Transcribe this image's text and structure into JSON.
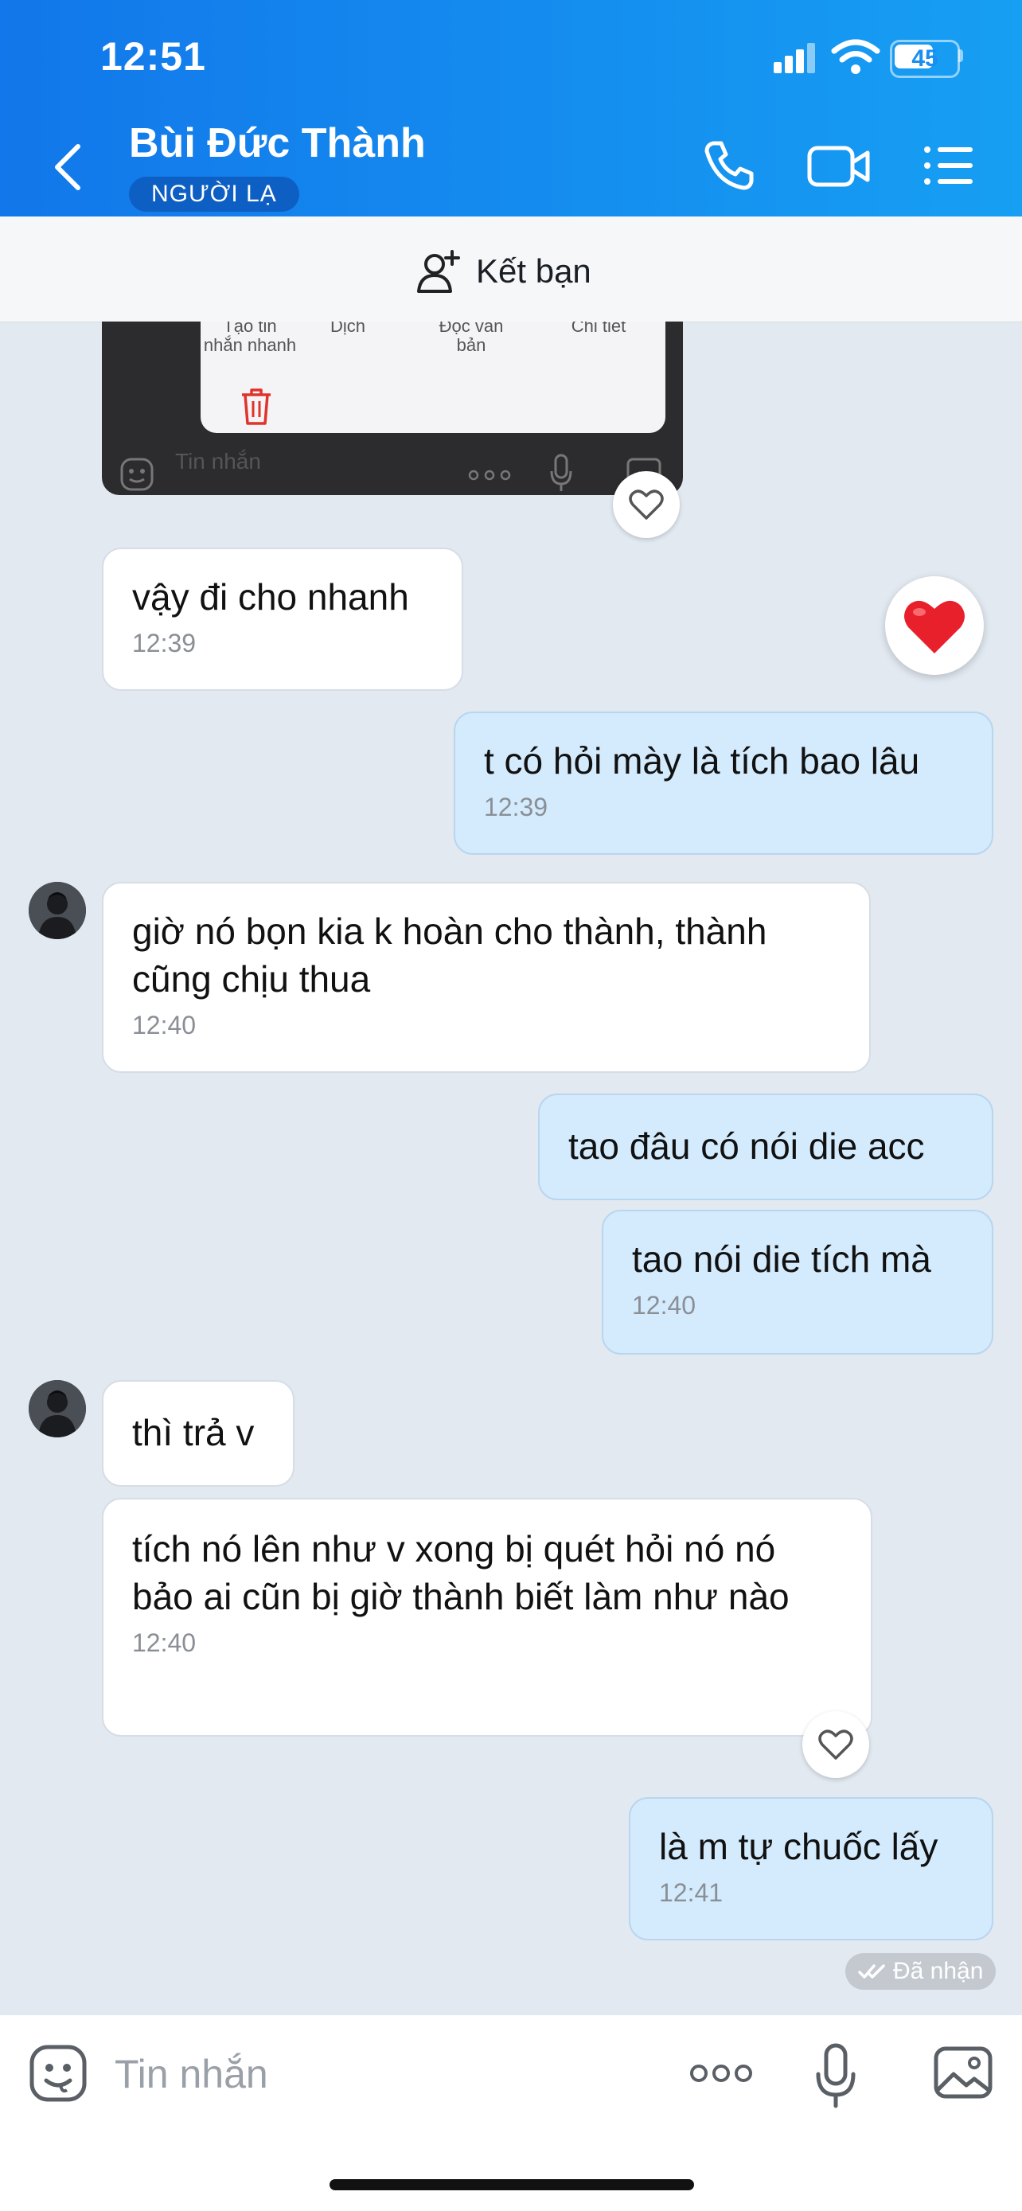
{
  "status": {
    "time": "12:51",
    "battery": "45"
  },
  "header": {
    "contact_name": "Bùi Đức Thành",
    "badge": "NGƯỜI LẠ"
  },
  "friend_bar": {
    "label": "Kết bạn"
  },
  "quoted_screenshot": {
    "actions": [
      "Tạo tin nhắn nhanh",
      "Dịch",
      "Đọc văn bản",
      "Chi tiết"
    ],
    "input_placeholder": "Tin nhắn"
  },
  "messages": [
    {
      "side": "in",
      "text": "vậy đi cho nhanh",
      "time": "12:39"
    },
    {
      "side": "out",
      "text": "t có hỏi mày là tích bao lâu",
      "time": "12:39"
    },
    {
      "side": "in",
      "text": "giờ nó bọn kia k hoàn cho thành, thành cũng chịu thua",
      "time": "12:40"
    },
    {
      "side": "out",
      "text": "tao đâu có nói die acc"
    },
    {
      "side": "out",
      "text": "tao nói die tích mà",
      "time": "12:40"
    },
    {
      "side": "in",
      "text": "thì trả v"
    },
    {
      "side": "in",
      "text": "tích nó lên như v xong bị quét hỏi nó nó bảo ai cũn bị giờ thành biết làm như nào",
      "time": "12:40"
    },
    {
      "side": "out",
      "text": "là m tự chuốc lấy",
      "time": "12:41"
    }
  ],
  "status_received": "Đã nhận",
  "composer": {
    "placeholder": "Tin nhắn"
  },
  "colors": {
    "header_start": "#1277ea",
    "header_end": "#169ff3",
    "outgoing_bubble": "#d4ebfd",
    "background": "#e2e9f1",
    "heart": "#e8202c"
  },
  "icons": [
    "back-icon",
    "phone-icon",
    "video-icon",
    "menu-icon",
    "add-friend-icon",
    "heart-icon",
    "sticker-icon",
    "more-icon",
    "mic-icon",
    "image-icon"
  ]
}
